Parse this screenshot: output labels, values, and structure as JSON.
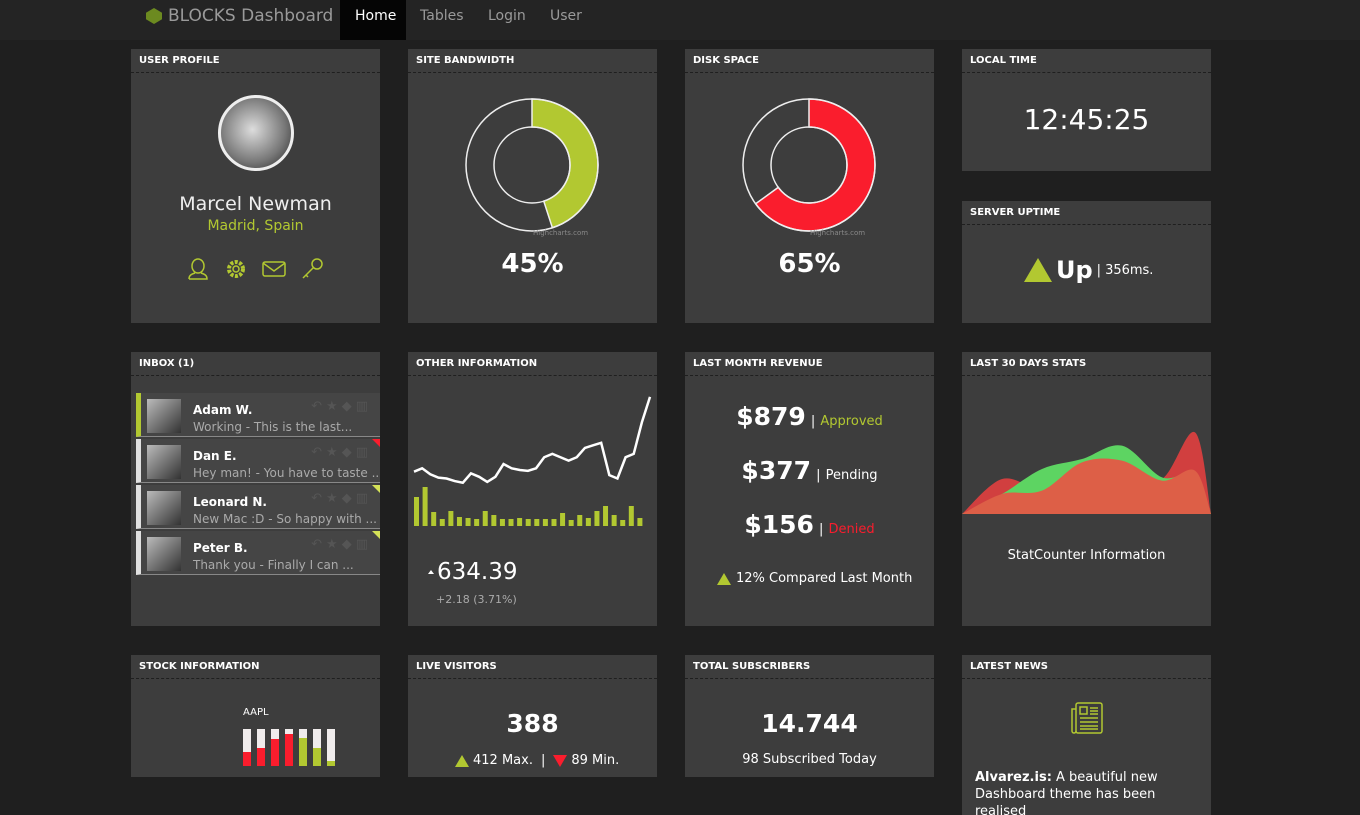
{
  "nav": {
    "brand": "BLOCKS Dashboard",
    "items": [
      "Home",
      "Tables",
      "Login",
      "User"
    ],
    "active": "Home"
  },
  "colors": {
    "accent": "#b2c831",
    "danger": "#fa1d2d",
    "panel": "#3d3d3d",
    "background": "#1f1f1f"
  },
  "profile": {
    "title": "USER PROFILE",
    "name": "Marcel Newman",
    "location": "Madrid, Spain",
    "icons": [
      "user-icon",
      "gear-icon",
      "mail-icon",
      "key-icon"
    ]
  },
  "bandwidth": {
    "title": "SITE BANDWIDTH",
    "percent": 45,
    "label": "45%",
    "credit": "Highcharts.com"
  },
  "disk": {
    "title": "DISK SPACE",
    "percent": 65,
    "label": "65%",
    "credit": "Highcharts.com"
  },
  "time": {
    "title": "LOCAL TIME",
    "value": "12:45:25"
  },
  "uptime": {
    "title": "SERVER UPTIME",
    "status": "Up",
    "sep": "|",
    "latency": "356ms."
  },
  "inbox": {
    "title": "INBOX (1)",
    "items": [
      {
        "name": "Adam W.",
        "preview": "Working - This is the last...",
        "unread": true,
        "flag": ""
      },
      {
        "name": "Dan E.",
        "preview": "Hey man! - You have to taste ...",
        "unread": false,
        "flag": "#fa1d2d"
      },
      {
        "name": "Leonard N.",
        "preview": "New Mac :D - So happy with ...",
        "unread": false,
        "flag": "#d4e157"
      },
      {
        "name": "Peter B.",
        "preview": "Thank you - Finally I can ...",
        "unread": false,
        "flag": "#d4e157"
      }
    ]
  },
  "other": {
    "title": "OTHER INFORMATION",
    "value": "634.39",
    "change": "+2.18 (3.71%)",
    "chart_data": {
      "type": "line+bar",
      "line": [
        38,
        42,
        35,
        31,
        30,
        27,
        25,
        36,
        32,
        26,
        32,
        47,
        42,
        40,
        39,
        42,
        55,
        59,
        55,
        51,
        55,
        66,
        69,
        72,
        34,
        30,
        55,
        59,
        96,
        126
      ],
      "bars": [
        29,
        39,
        14,
        7,
        15,
        9,
        8,
        7,
        15,
        11,
        7,
        7,
        8,
        7,
        7,
        7,
        7,
        13,
        6,
        11,
        8,
        15,
        20,
        11,
        6,
        20,
        8
      ]
    }
  },
  "revenue": {
    "title": "LAST MONTH REVENUE",
    "rows": [
      {
        "amount": "$879",
        "sep": "|",
        "status": "Approved"
      },
      {
        "amount": "$377",
        "sep": "|",
        "status": "Pending"
      },
      {
        "amount": "$156",
        "sep": "|",
        "status": "Denied"
      }
    ],
    "compare": "12% Compared Last Month"
  },
  "stats": {
    "title": "LAST 30 DAYS STATS",
    "caption": "StatCounter Information",
    "chart_data": {
      "type": "area",
      "series": [
        {
          "color": "#d13f3f",
          "values": [
            0,
            105,
            70,
            80,
            110,
            105,
            245,
            0
          ]
        },
        {
          "color": "#5dd462",
          "values": [
            0,
            60,
            135,
            165,
            205,
            110,
            120,
            0
          ]
        },
        {
          "color": "#dd5f47",
          "values": [
            0,
            60,
            70,
            155,
            160,
            100,
            130,
            0
          ]
        }
      ]
    }
  },
  "stock": {
    "title": "STOCK INFORMATION",
    "symbol": "AAPL",
    "chart_data": {
      "type": "bar",
      "values": [
        0.38,
        0.48,
        0.72,
        0.87,
        0.75,
        0.5,
        0.14
      ],
      "colors": [
        "#fa1d2d",
        "#fa1d2d",
        "#fa1d2d",
        "#fa1d2d",
        "#b2c831",
        "#b2c831",
        "#b2c831"
      ]
    }
  },
  "visitors": {
    "title": "LIVE VISITORS",
    "value": "388",
    "max": "412 Max.",
    "sep": "|",
    "min": "89 Min."
  },
  "subscribers": {
    "title": "TOTAL SUBSCRIBERS",
    "value": "14.744",
    "today": "98 Subscribed Today"
  },
  "news": {
    "title": "LATEST NEWS",
    "source": "Alvarez.is:",
    "text": "A beautiful new Dashboard theme has been realised"
  }
}
